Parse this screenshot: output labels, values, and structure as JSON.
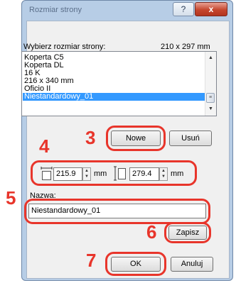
{
  "window": {
    "title": "Rozmiar strony",
    "help_label": "?",
    "close_label": "x"
  },
  "page_size": {
    "label": "Wybierz rozmiar strony:",
    "current": "210 x 297 mm"
  },
  "list": {
    "items": [
      "Koperta C5",
      "Koperta DL",
      "16 K",
      "216 x 340 mm",
      "Oficio II",
      "Niestandardowy_01"
    ],
    "selected": "Niestandardowy_01"
  },
  "buttons": {
    "new": "Nowe",
    "delete": "Usuń",
    "save": "Zapisz",
    "ok": "OK",
    "cancel": "Anuluj"
  },
  "dimensions": {
    "width": "215.9",
    "height": "279.4",
    "unit": "mm"
  },
  "name": {
    "label": "Nazwa:",
    "value": "Niestandardowy_01"
  },
  "steps": [
    "3",
    "4",
    "5",
    "6",
    "7"
  ],
  "colors": {
    "highlight": "#e8352b",
    "selection": "#3399ff",
    "frame": "#b7cde6"
  }
}
